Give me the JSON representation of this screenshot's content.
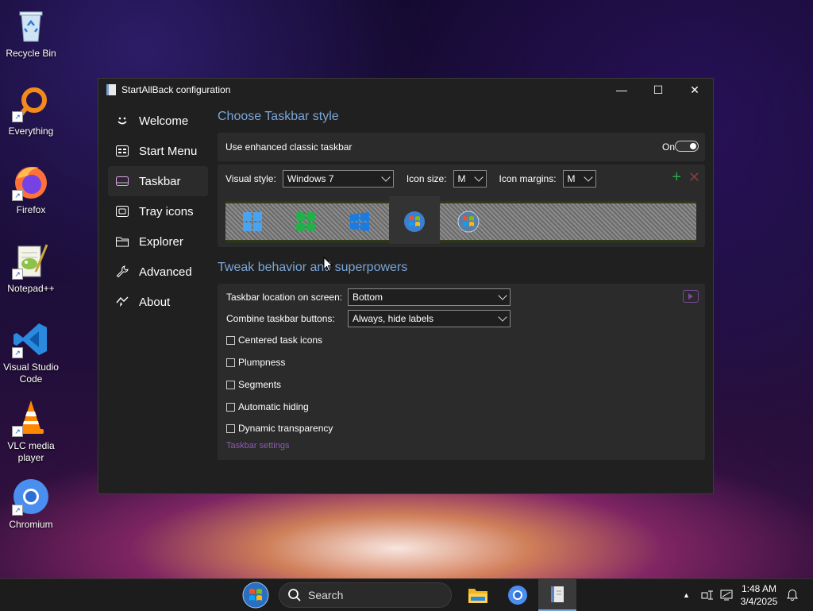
{
  "desktop": {
    "icons": [
      {
        "label": "Recycle Bin"
      },
      {
        "label": "Everything"
      },
      {
        "label": "Firefox"
      },
      {
        "label": "Notepad++"
      },
      {
        "label": "Visual Studio Code"
      },
      {
        "label": "VLC media player"
      },
      {
        "label": "Chromium"
      }
    ]
  },
  "window": {
    "title": "StartAllBack configuration",
    "buttons": {
      "minimize": "—",
      "maximize": "☐",
      "close": "✕"
    }
  },
  "sidebar": {
    "items": [
      {
        "label": "Welcome",
        "icon": "smile-icon"
      },
      {
        "label": "Start Menu",
        "icon": "start-menu-icon"
      },
      {
        "label": "Taskbar",
        "icon": "taskbar-icon",
        "active": true
      },
      {
        "label": "Tray icons",
        "icon": "tray-icon"
      },
      {
        "label": "Explorer",
        "icon": "folder-icon"
      },
      {
        "label": "Advanced",
        "icon": "wrench-icon"
      },
      {
        "label": "About",
        "icon": "about-icon"
      }
    ]
  },
  "main": {
    "section1_title": "Choose Taskbar style",
    "enhanced_label": "Use enhanced classic taskbar",
    "toggle_state": "On",
    "visual_style_label": "Visual style:",
    "visual_style_value": "Windows 7",
    "icon_size_label": "Icon size:",
    "icon_size_value": "M",
    "icon_margins_label": "Icon margins:",
    "icon_margins_value": "M",
    "add_symbol": "+",
    "remove_symbol": "✕",
    "section2_title": "Tweak behavior and superpowers",
    "location_label": "Taskbar location on screen:",
    "location_value": "Bottom",
    "combine_label": "Combine taskbar buttons:",
    "combine_value": "Always, hide labels",
    "checkboxes": [
      {
        "label": "Centered task icons",
        "checked": false
      },
      {
        "label": "Plumpness",
        "checked": false
      },
      {
        "label": "Segments",
        "checked": false
      },
      {
        "label": "Automatic hiding",
        "checked": false
      },
      {
        "label": "Dynamic transparency",
        "checked": false
      }
    ],
    "settings_link": "Taskbar settings"
  },
  "taskbar": {
    "search_placeholder": "Search",
    "clock_time": "1:48 AM",
    "clock_date": "3/4/2025"
  },
  "colors": {
    "accent": "#7aa6d8",
    "link": "#8b5bb0",
    "window_bg": "#202020",
    "panel_bg": "#2b2b2b"
  }
}
